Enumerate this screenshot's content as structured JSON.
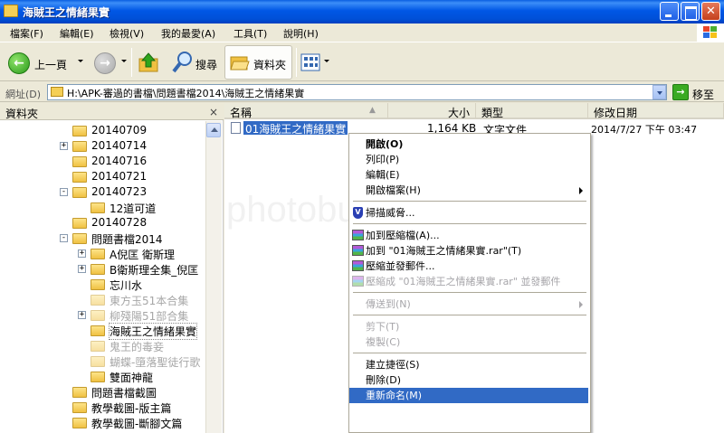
{
  "window": {
    "title": "海賊王之情緒果實"
  },
  "menubar": [
    {
      "label": "檔案(F)",
      "underline_hint": "F"
    },
    {
      "label": "編輯(E)"
    },
    {
      "label": "檢視(V)"
    },
    {
      "label": "我的最愛(A)"
    },
    {
      "label": "工具(T)"
    },
    {
      "label": "說明(H)"
    }
  ],
  "toolbar": {
    "back_label": "上一頁",
    "search_label": "搜尋",
    "folders_label": "資料夾"
  },
  "address": {
    "label": "網址(D)",
    "value": "H:\\APK-審過的書檔\\問題書檔2014\\海賊王之情緒果實",
    "go_label": "移至"
  },
  "folder_pane": {
    "title": "資料夾",
    "close": "×",
    "tree": [
      {
        "label": "20140709",
        "expander": "",
        "indent": 0,
        "faded": false
      },
      {
        "label": "20140714",
        "expander": "+",
        "indent": 0,
        "faded": false
      },
      {
        "label": "20140716",
        "expander": "",
        "indent": 0,
        "faded": false
      },
      {
        "label": "20140721",
        "expander": "",
        "indent": 0,
        "faded": false
      },
      {
        "label": "20140723",
        "expander": "−",
        "indent": 0,
        "faded": false
      },
      {
        "label": "12道可道",
        "expander": "",
        "indent": 1,
        "faded": false
      },
      {
        "label": "20140728",
        "expander": "",
        "indent": 0,
        "faded": false
      },
      {
        "label": "問題書檔2014",
        "expander": "−",
        "indent": 0,
        "faded": false
      },
      {
        "label": "A倪匡 衛斯理",
        "expander": "+",
        "indent": 1,
        "faded": false
      },
      {
        "label": "B衛斯理全集_倪匡",
        "expander": "+",
        "indent": 1,
        "faded": false
      },
      {
        "label": "忘川水",
        "expander": "",
        "indent": 1,
        "faded": false
      },
      {
        "label": "東方玉51本合集",
        "expander": "",
        "indent": 1,
        "faded": true
      },
      {
        "label": "柳殘陽51部合集",
        "expander": "+",
        "indent": 1,
        "faded": true
      },
      {
        "label": "海賊王之情緒果實",
        "expander": "",
        "indent": 1,
        "faded": false,
        "selected": true
      },
      {
        "label": "鬼王的毒妾",
        "expander": "",
        "indent": 1,
        "faded": true
      },
      {
        "label": "蝴蝶-墮落聖徒行歌",
        "expander": "",
        "indent": 1,
        "faded": true
      },
      {
        "label": "雙面神龍",
        "expander": "",
        "indent": 1,
        "faded": false
      },
      {
        "label": "問題書檔截圖",
        "expander": "",
        "indent": 0,
        "faded": false
      },
      {
        "label": "教學截圖-版主篇",
        "expander": "",
        "indent": 0,
        "faded": false
      },
      {
        "label": "教學截圖-斷腳文篇",
        "expander": "",
        "indent": 0,
        "faded": false
      }
    ]
  },
  "list": {
    "columns": [
      "名稱",
      "大小",
      "類型",
      "修改日期"
    ],
    "sort_indicator": "▲",
    "rows": [
      {
        "name": "01海賊王之情緒果實",
        "size": "1,164 KB",
        "type": "文字文件",
        "modified": "2014/7/27 下午 03:47"
      }
    ]
  },
  "watermark": "photobucket",
  "context_menu": {
    "items": [
      {
        "label": "開啟(O)",
        "bold": true
      },
      {
        "label": "列印(P)"
      },
      {
        "label": "編輯(E)"
      },
      {
        "label": "開啟檔案(H)",
        "submenu": true
      },
      {
        "sep": true
      },
      {
        "label": "掃描威脅...",
        "icon": "shield"
      },
      {
        "sep": true
      },
      {
        "label": "加到壓縮檔(A)...",
        "icon": "rar"
      },
      {
        "label": "加到 \"01海賊王之情緒果實.rar\"(T)",
        "icon": "rar"
      },
      {
        "label": "壓縮並發郵件...",
        "icon": "rar"
      },
      {
        "label": "壓縮成 \"01海賊王之情緒果實.rar\" 並發郵件",
        "icon": "rar",
        "disabled": true
      },
      {
        "sep": true
      },
      {
        "label": "傳送到(N)",
        "submenu": true,
        "disabled": true
      },
      {
        "sep": true
      },
      {
        "label": "剪下(T)",
        "disabled": true
      },
      {
        "label": "複製(C)",
        "disabled": true
      },
      {
        "sep": true
      },
      {
        "label": "建立捷徑(S)"
      },
      {
        "label": "刪除(D)"
      },
      {
        "label": "重新命名(M)",
        "highlighted": true
      }
    ]
  },
  "colors": {
    "titlebar": "#0054e3",
    "selection": "#316ac5",
    "folder": "#f0c142"
  }
}
